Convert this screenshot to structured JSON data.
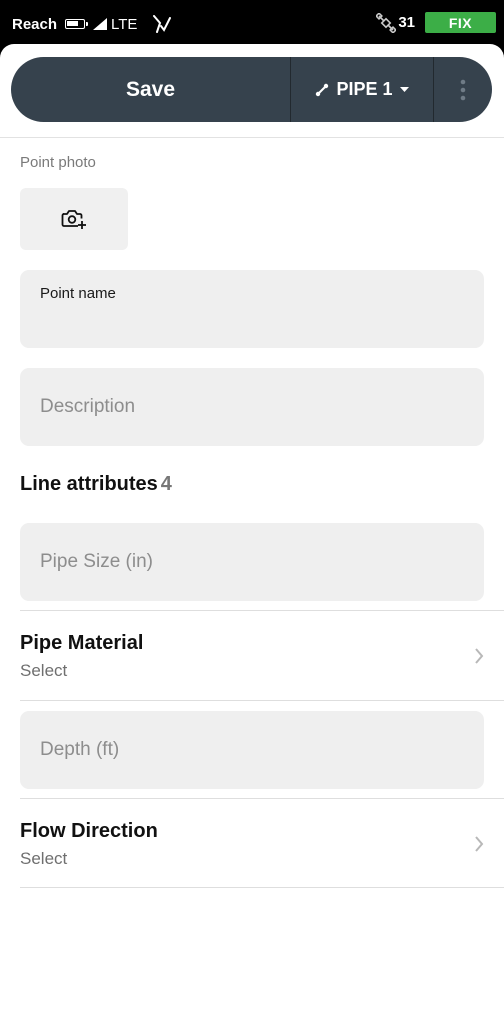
{
  "status_bar": {
    "carrier": "Reach",
    "battery_level": 0.7,
    "network": "LTE",
    "satellite_count": "31",
    "fix_status": "FIX",
    "fix_color": "#3cae47"
  },
  "toolbar": {
    "save_label": "Save",
    "layer_label": "PIPE 1",
    "background_color": "#36424d"
  },
  "point_photo": {
    "label": "Point photo",
    "icon": "add-photo-camera-icon"
  },
  "point_name": {
    "label": "Point name",
    "value": ""
  },
  "description": {
    "placeholder": "Description"
  },
  "line_attributes": {
    "title": "Line attributes",
    "count": "4",
    "items": [
      {
        "type": "input",
        "placeholder": "Pipe Size (in)"
      },
      {
        "type": "select",
        "title": "Pipe Material",
        "value": "Select"
      },
      {
        "type": "input",
        "placeholder": "Depth (ft)"
      },
      {
        "type": "select",
        "title": "Flow Direction",
        "value": "Select"
      }
    ]
  }
}
